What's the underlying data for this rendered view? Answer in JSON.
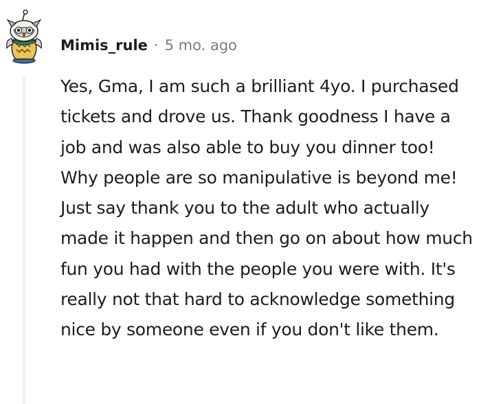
{
  "comment": {
    "username": "Mimis_rule",
    "separator": "·",
    "timestamp": "5 mo. ago",
    "body": "Yes, Gma, I am such a brilliant 4yo. I purchased tickets and drove us. Thank goodness I have a job and was also able to buy you dinner too! Why people are so manipulative is beyond me! Just say thank you to the adult who actually made it happen and then go on about how much fun you had with the people you were with. It's really not that hard to acknowledge something nice by someone even if you don't like them.",
    "avatar_icon": "owl-snoo-avatar-icon"
  }
}
